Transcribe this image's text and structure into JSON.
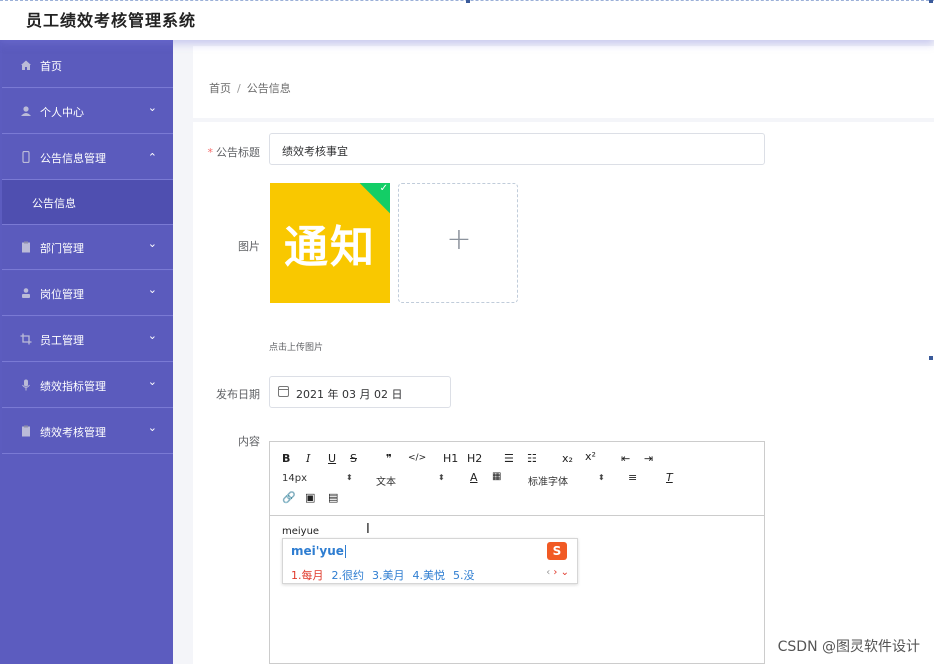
{
  "app": {
    "title": "员工绩效考核管理系统"
  },
  "sidebar": {
    "items": [
      {
        "label": "首页",
        "icon": "home-icon",
        "arrow": ""
      },
      {
        "label": "个人中心",
        "icon": "user-icon",
        "arrow": "⌄"
      },
      {
        "label": "公告信息管理",
        "icon": "phone-icon",
        "arrow": "⌃"
      },
      {
        "label": "部门管理",
        "icon": "clipboard-icon",
        "arrow": "⌄"
      },
      {
        "label": "岗位管理",
        "icon": "person-icon",
        "arrow": "⌄"
      },
      {
        "label": "员工管理",
        "icon": "crop-icon",
        "arrow": "⌄"
      },
      {
        "label": "绩效指标管理",
        "icon": "mic-icon",
        "arrow": "⌄"
      },
      {
        "label": "绩效考核管理",
        "icon": "clipboard-icon",
        "arrow": "⌄"
      }
    ],
    "subitems": [
      {
        "label": "公告信息"
      }
    ]
  },
  "breadcrumb": {
    "home": "首页",
    "separator": "/",
    "current": "公告信息"
  },
  "form": {
    "title_label": "公告标题",
    "title_value": "绩效考核事宜",
    "image_label": "图片",
    "image_text": "通知",
    "upload_hint": "点击上传图片",
    "date_label": "发布日期",
    "date_value": "2021 年 03 月 02 日",
    "content_label": "内容"
  },
  "editor": {
    "toolbar_row1": [
      "B",
      "I",
      "U",
      "S",
      "❞",
      "</>",
      "H1",
      "H2",
      "☰",
      "☷",
      "x₂",
      "x²",
      "⇤",
      "⇥"
    ],
    "font_size": "14px",
    "text_type": "文本",
    "font_color": "A",
    "font_family": "标准字体",
    "content_text": "meiyue"
  },
  "ime": {
    "composition": "mei'yue",
    "candidates": [
      "1.每月",
      "2.很约",
      "3.美月",
      "4.美悦",
      "5.没"
    ],
    "logo": "S"
  },
  "watermark": "CSDN @图灵软件设计",
  "colors": {
    "sidebar": "#5c5cbf",
    "sidebar_sub": "#4f4fb0",
    "thumb": "#f9c800",
    "success": "#13ce66",
    "ime_blue": "#2e7dd1",
    "ime_red": "#e0392b"
  }
}
